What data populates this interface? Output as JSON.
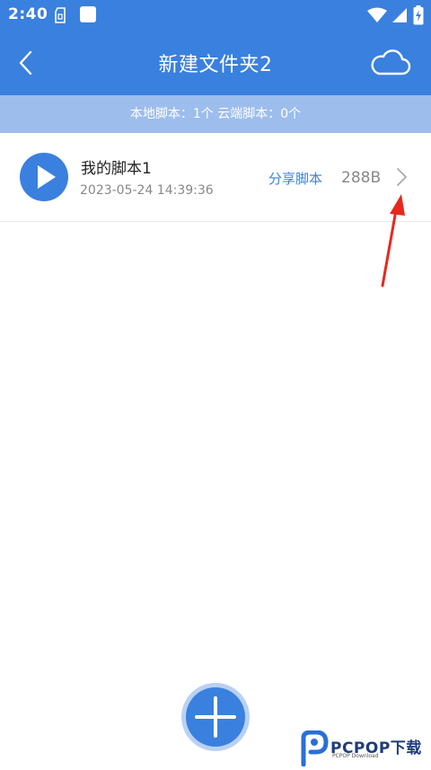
{
  "status_bar": {
    "time": "2:40",
    "icons": [
      "sim-card-icon",
      "notification-square-icon",
      "wifi-icon",
      "signal-icon",
      "battery-charging-icon"
    ]
  },
  "header": {
    "title": "新建文件夹2",
    "back_icon": "chevron-left-icon",
    "cloud_icon": "cloud-icon"
  },
  "summary": {
    "text": "本地脚本：1个 云端脚本：0个"
  },
  "scripts": [
    {
      "name": "我的脚本1",
      "date": "2023-05-24 14:39:36",
      "share_label": "分享脚本",
      "size": "288B",
      "play_icon": "play-icon",
      "chevron_icon": "chevron-right-icon"
    }
  ],
  "fab": {
    "icon": "plus-icon"
  },
  "watermark": {
    "text": "PCPOP下载",
    "sub": "PCPOP Download"
  },
  "colors": {
    "primary": "#3a80de",
    "subbar": "#9dbdec",
    "annotation_arrow": "#e8281f"
  }
}
